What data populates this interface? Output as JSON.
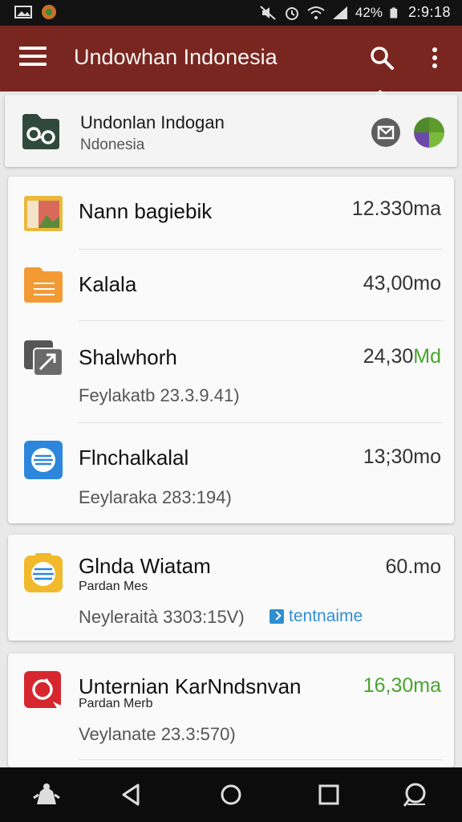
{
  "status_bar": {
    "battery": "42%",
    "time": "2:9:18",
    "icons": [
      "gallery-icon",
      "app-notification-icon",
      "mute-icon",
      "alarm-icon",
      "wifi-icon",
      "signal-icon",
      "battery-icon"
    ]
  },
  "app_bar": {
    "title": "Undowhan Indonesia",
    "icons": [
      "menu-icon",
      "search-icon",
      "more-vert-icon"
    ],
    "color": "#7a2620"
  },
  "header": {
    "title": "Undonlan Indogan",
    "subtitle": "Ndonesia",
    "icons": [
      "app-logo-icon",
      "mail-icon",
      "pie-chart-icon"
    ]
  },
  "group1": [
    {
      "name": "Nann bagiebik",
      "size": "12.330ma",
      "icon": "image-folder-icon"
    },
    {
      "name": "Kalala",
      "size": "43,00mo",
      "icon": "folder-icon"
    },
    {
      "name": "Shalwhorh",
      "size_main": "24,30",
      "size_unit": "Md",
      "meta": "Feylakatb 23.3.9.41)",
      "icon": "media-icon"
    },
    {
      "name": "Flnchalkalal",
      "size": "13;30mo",
      "meta": "Eeylaraka 283:194)",
      "icon": "document-icon"
    }
  ],
  "group2": [
    {
      "name": "Glnda Wiatam",
      "sub": "Pardan Mes",
      "size": "60.mo",
      "meta": "Neyleraità 3303:15V)",
      "tag": "tentnaime",
      "icon": "notes-icon"
    }
  ],
  "group3": [
    {
      "name": "Unternian KarNndsnvan",
      "sub": "Pardan Merb",
      "size": "16,30ma",
      "meta": "Veylanate 23.3:570)",
      "icon": "red-app-icon"
    }
  ],
  "nav_bar": {
    "icons": [
      "assistant-icon",
      "back-icon",
      "home-icon",
      "recents-icon",
      "search-nav-icon"
    ]
  }
}
